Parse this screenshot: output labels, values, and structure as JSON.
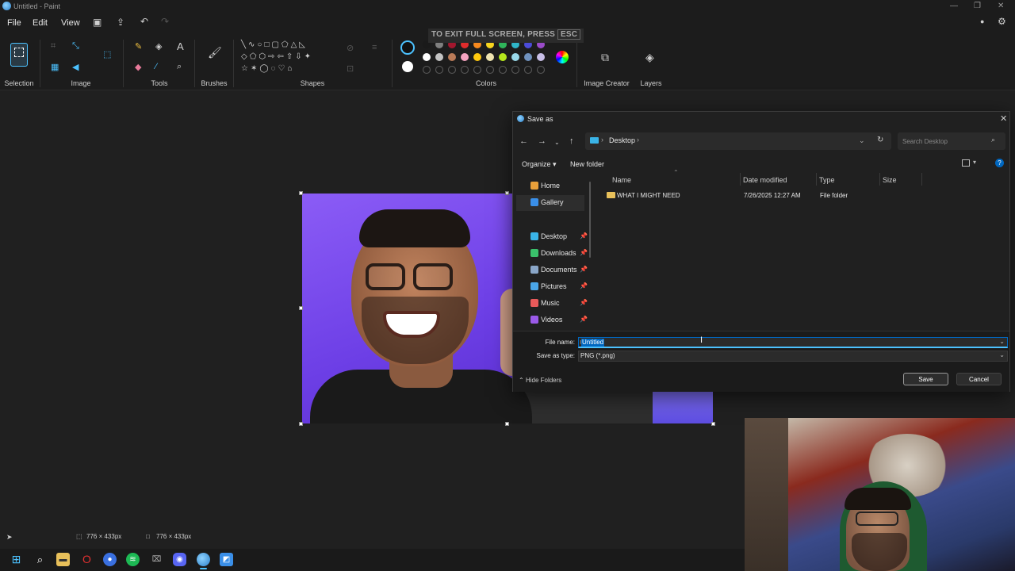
{
  "window": {
    "title": "Untitled - Paint"
  },
  "menu": {
    "file": "File",
    "edit": "Edit",
    "view": "View"
  },
  "ribbon": {
    "groups": {
      "selection": "Selection",
      "image": "Image",
      "tools": "Tools",
      "brushes": "Brushes",
      "shapes": "Shapes",
      "colors": "Colors",
      "image_creator": "Image Creator",
      "layers": "Layers"
    },
    "palette_row1": [
      "#1a1a1a",
      "#7f7f7f",
      "#a3172e",
      "#e02c2c",
      "#f7891e",
      "#f7d51e",
      "#2fb45a",
      "#2fb5c8",
      "#4b4bd8",
      "#9a4bc8"
    ],
    "palette_row2": [
      "#ffffff",
      "#c3c3c3",
      "#b97a57",
      "#f5a3c0",
      "#ffc90e",
      "#efe4b0",
      "#b5e61d",
      "#99d9ea",
      "#7092be",
      "#c8bfe7"
    ],
    "primary_color": "#111111",
    "secondary_color": "#ffffff"
  },
  "fullscreen_hint": {
    "text": "TO EXIT FULL SCREEN, PRESS",
    "key": "ESC"
  },
  "dialog": {
    "title": "Save as",
    "breadcrumb": "Desktop",
    "search_placeholder": "Search Desktop",
    "organize": "Organize",
    "new_folder": "New folder",
    "nav": [
      {
        "label": "Home",
        "color": "#e8a03a"
      },
      {
        "label": "Gallery",
        "color": "#3a8fe8"
      },
      {
        "label": "Desktop",
        "color": "#3ab4e8"
      },
      {
        "label": "Downloads",
        "color": "#3ac06b"
      },
      {
        "label": "Documents",
        "color": "#8aa6c8"
      },
      {
        "label": "Pictures",
        "color": "#4aa6e8"
      },
      {
        "label": "Music",
        "color": "#e85a5a"
      },
      {
        "label": "Videos",
        "color": "#9a5ae8"
      }
    ],
    "columns": {
      "name": "Name",
      "date": "Date modified",
      "type": "Type",
      "size": "Size"
    },
    "files": [
      {
        "name": "WHAT I MIGHT NEED",
        "date": "7/26/2025 12:27 AM",
        "type": "File folder",
        "size": ""
      }
    ],
    "file_name_label": "File name:",
    "file_name_value": "Untitled",
    "save_type_label": "Save as type:",
    "save_type_value": "PNG (*.png)",
    "hide_folders": "Hide Folders",
    "save": "Save",
    "cancel": "Cancel"
  },
  "status": {
    "selection_size": "776 × 433px",
    "canvas_size": "776 × 433px"
  }
}
